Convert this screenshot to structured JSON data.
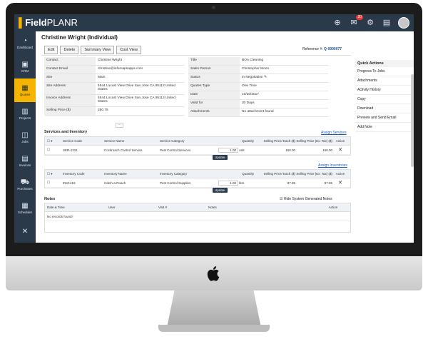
{
  "app": {
    "logo_prefix": "Field",
    "logo_suffix": "PLANR",
    "badge_count": "20"
  },
  "sidebar": {
    "items": [
      {
        "label": "Dashboard",
        "icon": "dashboard-icon"
      },
      {
        "label": "CRM",
        "icon": "contacts-icon"
      },
      {
        "label": "Quotes",
        "icon": "clipboard-icon",
        "active": true
      },
      {
        "label": "Projects",
        "icon": "projects-icon"
      },
      {
        "label": "Jobs",
        "icon": "briefcase-icon"
      },
      {
        "label": "Invoices",
        "icon": "invoice-icon"
      },
      {
        "label": "Purchases",
        "icon": "cart-icon"
      },
      {
        "label": "Scheduler",
        "icon": "calendar-icon"
      },
      {
        "label": "",
        "icon": "tools-icon"
      }
    ]
  },
  "page": {
    "title": "Christine Wright (Individual)",
    "reference_label": "Reference #:",
    "reference_value": "Q-0000077"
  },
  "toolbar": {
    "edit": "Edit",
    "delete": "Delete",
    "summary": "Summary View",
    "cost": "Cost View"
  },
  "fields_left": [
    {
      "label": "Contact",
      "value": "Christine Wright"
    },
    {
      "label": "Contact Email",
      "value": "christine@infomapsapps.com"
    },
    {
      "label": "Site",
      "value": "Main"
    },
    {
      "label": "Site Address",
      "value": "4644 Locust View Drive San Jose CA 95113 United States"
    },
    {
      "label": "Invoice Address",
      "value": "4644 Locust View Drive San Jose CA 95113 United States"
    },
    {
      "label": "Selling Price ($)",
      "value": "280.75"
    }
  ],
  "fields_right": [
    {
      "label": "Title",
      "value": "BOA Cleaning"
    },
    {
      "label": "Sales Person",
      "value": "Christopher Moon"
    },
    {
      "label": "Status",
      "value": "In Negotiation"
    },
    {
      "label": "Quotes Type",
      "value": "One Time"
    },
    {
      "label": "Date",
      "value": "10/20/2017"
    },
    {
      "label": "Valid for",
      "value": "30 Days"
    },
    {
      "label": "Attachments",
      "value": "No attachment found"
    }
  ],
  "services": {
    "heading": "Services and Inventory",
    "assign_link": "Assign Services",
    "columns": [
      "Service Code",
      "Service Name",
      "Service Category",
      "Quantity",
      "Selling Price/ Each ($)",
      "Selling Price (Ex. Tax) ($)",
      "Action"
    ],
    "rows": [
      {
        "code": "SER-1321",
        "name": "Cockroach Control Service",
        "category": "Pest Control Services",
        "quantity": "1.00",
        "unit": "unit",
        "price_each": "160.00",
        "price_ex_tax": "160.00"
      }
    ],
    "update": "Update"
  },
  "inventory": {
    "assign_link": "Assign Inventories",
    "columns": [
      "Inventory Code",
      "Inventory Name",
      "Inventory Category",
      "Quantity",
      "Selling Price/ Each ($)",
      "Selling Price (Ex. Tax) ($)",
      "Action"
    ],
    "rows": [
      {
        "code": "INV1419",
        "name": "Catch-a-Roach",
        "category": "Pest Control Supplies",
        "quantity": "1.00",
        "unit": "litre",
        "price_each": "87.95",
        "price_ex_tax": "87.95"
      }
    ],
    "update": "Update"
  },
  "notes": {
    "heading": "Notes",
    "hide_label": "Hide System Generated Notes",
    "columns": [
      "Date & Time",
      "User",
      "Visit #",
      "Notes",
      "Action"
    ],
    "empty": "No records found!"
  },
  "quick_actions": {
    "title": "Quick Actions",
    "items": [
      "Progress To Jobs",
      "Attachments",
      "Activity History",
      "Copy",
      "Download",
      "Preview and Send Email",
      "Add Note"
    ]
  }
}
